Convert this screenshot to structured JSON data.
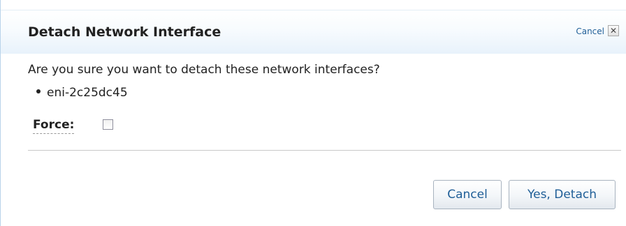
{
  "dialog": {
    "title": "Detach Network Interface",
    "header_cancel_label": "Cancel",
    "close_glyph": "✕",
    "question": "Are you sure you want to detach these network interfaces?",
    "interfaces": [
      "eni-2c25dc45"
    ],
    "force_label": "Force:",
    "force_checked": false,
    "cancel_button_label": "Cancel",
    "confirm_button_label": "Yes, Detach"
  },
  "colors": {
    "link": "#1f5e97",
    "text": "#222222",
    "header_gradient_end": "#e8f2fb",
    "divider": "#c9c9c9"
  },
  "icons": {
    "close": "close-icon",
    "bullet": "bullet-icon"
  }
}
